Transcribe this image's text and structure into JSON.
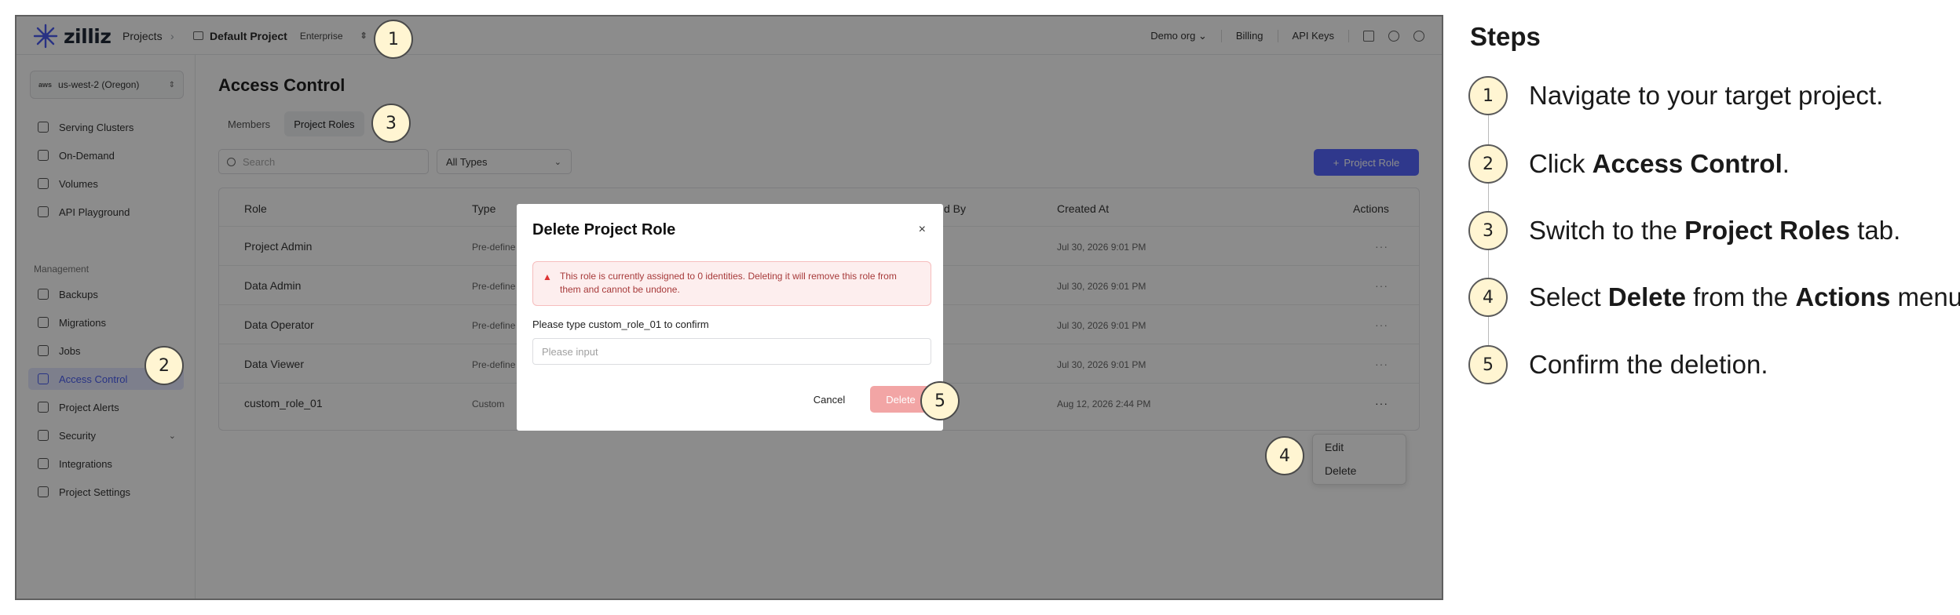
{
  "topbar": {
    "brand": "zilliz",
    "projects": "Projects",
    "sep": "›",
    "project_name": "Default Project",
    "plan": "Enterprise",
    "org": "Demo org",
    "billing": "Billing",
    "api_keys": "API Keys"
  },
  "sidebar": {
    "region": "us-west-2 (Oregon)",
    "region_provider": "aws",
    "items": [
      {
        "label": "Serving Clusters"
      },
      {
        "label": "On-Demand"
      },
      {
        "label": "Volumes"
      },
      {
        "label": "API Playground"
      }
    ],
    "management_label": "Management",
    "management_items": [
      {
        "label": "Backups"
      },
      {
        "label": "Migrations"
      },
      {
        "label": "Jobs"
      },
      {
        "label": "Access Control"
      },
      {
        "label": "Project Alerts"
      },
      {
        "label": "Security"
      },
      {
        "label": "Integrations"
      },
      {
        "label": "Project Settings"
      }
    ]
  },
  "main": {
    "title": "Access Control",
    "tabs": [
      "Members",
      "Project Roles"
    ],
    "search_placeholder": "Search",
    "type_filter": "All Types",
    "add_button": "Project Role",
    "columns": {
      "role": "Role",
      "type": "Type",
      "created_by": "d By",
      "created_at": "Created At",
      "actions": "Actions"
    },
    "rows": [
      {
        "role": "Project Admin",
        "type": "Pre-define",
        "created_at": "Jul 30, 2026 9:01 PM",
        "actions": "···"
      },
      {
        "role": "Data Admin",
        "type": "Pre-define",
        "created_at": "Jul 30, 2026 9:01 PM",
        "actions": "···"
      },
      {
        "role": "Data Operator",
        "type": "Pre-define",
        "created_at": "Jul 30, 2026 9:01 PM",
        "actions": "···"
      },
      {
        "role": "Data Viewer",
        "type": "Pre-define",
        "created_at": "Jul 30, 2026 9:01 PM",
        "actions": "···"
      },
      {
        "role": "custom_role_01",
        "type": "Custom",
        "created_at": "Aug 12, 2026 2:44 PM",
        "actions": "···"
      }
    ],
    "menu": {
      "edit": "Edit",
      "delete": "Delete"
    }
  },
  "modal": {
    "title": "Delete Project Role",
    "close": "×",
    "alert": "This role is currently assigned to 0 identities. Deleting it will remove this role from them and cannot be undone.",
    "confirm_label": "Please type custom_role_01 to confirm",
    "input_placeholder": "Please input",
    "cancel": "Cancel",
    "delete": "Delete"
  },
  "markers": [
    "1",
    "2",
    "3",
    "4",
    "5"
  ],
  "steps_panel": {
    "title": "Steps",
    "steps": [
      {
        "num": "1",
        "pre": "Navigate to your target project.",
        "b1": "",
        "mid": "",
        "b2": "",
        "post": ""
      },
      {
        "num": "2",
        "pre": "Click ",
        "b1": "Access Control",
        "mid": ".",
        "b2": "",
        "post": ""
      },
      {
        "num": "3",
        "pre": "Switch to the ",
        "b1": "Project Roles",
        "mid": " tab.",
        "b2": "",
        "post": ""
      },
      {
        "num": "4",
        "pre": "Select ",
        "b1": "Delete",
        "mid": " from the ",
        "b2": "Actions",
        "post": " menu."
      },
      {
        "num": "5",
        "pre": "Confirm the deletion.",
        "b1": "",
        "mid": "",
        "b2": "",
        "post": ""
      }
    ]
  },
  "colors": {
    "accent": "#5767ff",
    "active_bg": "#e4e8ff",
    "danger_bg": "#fdeeee",
    "delete_btn": "#f2a5a5",
    "marker_fill": "#fff5d2"
  }
}
